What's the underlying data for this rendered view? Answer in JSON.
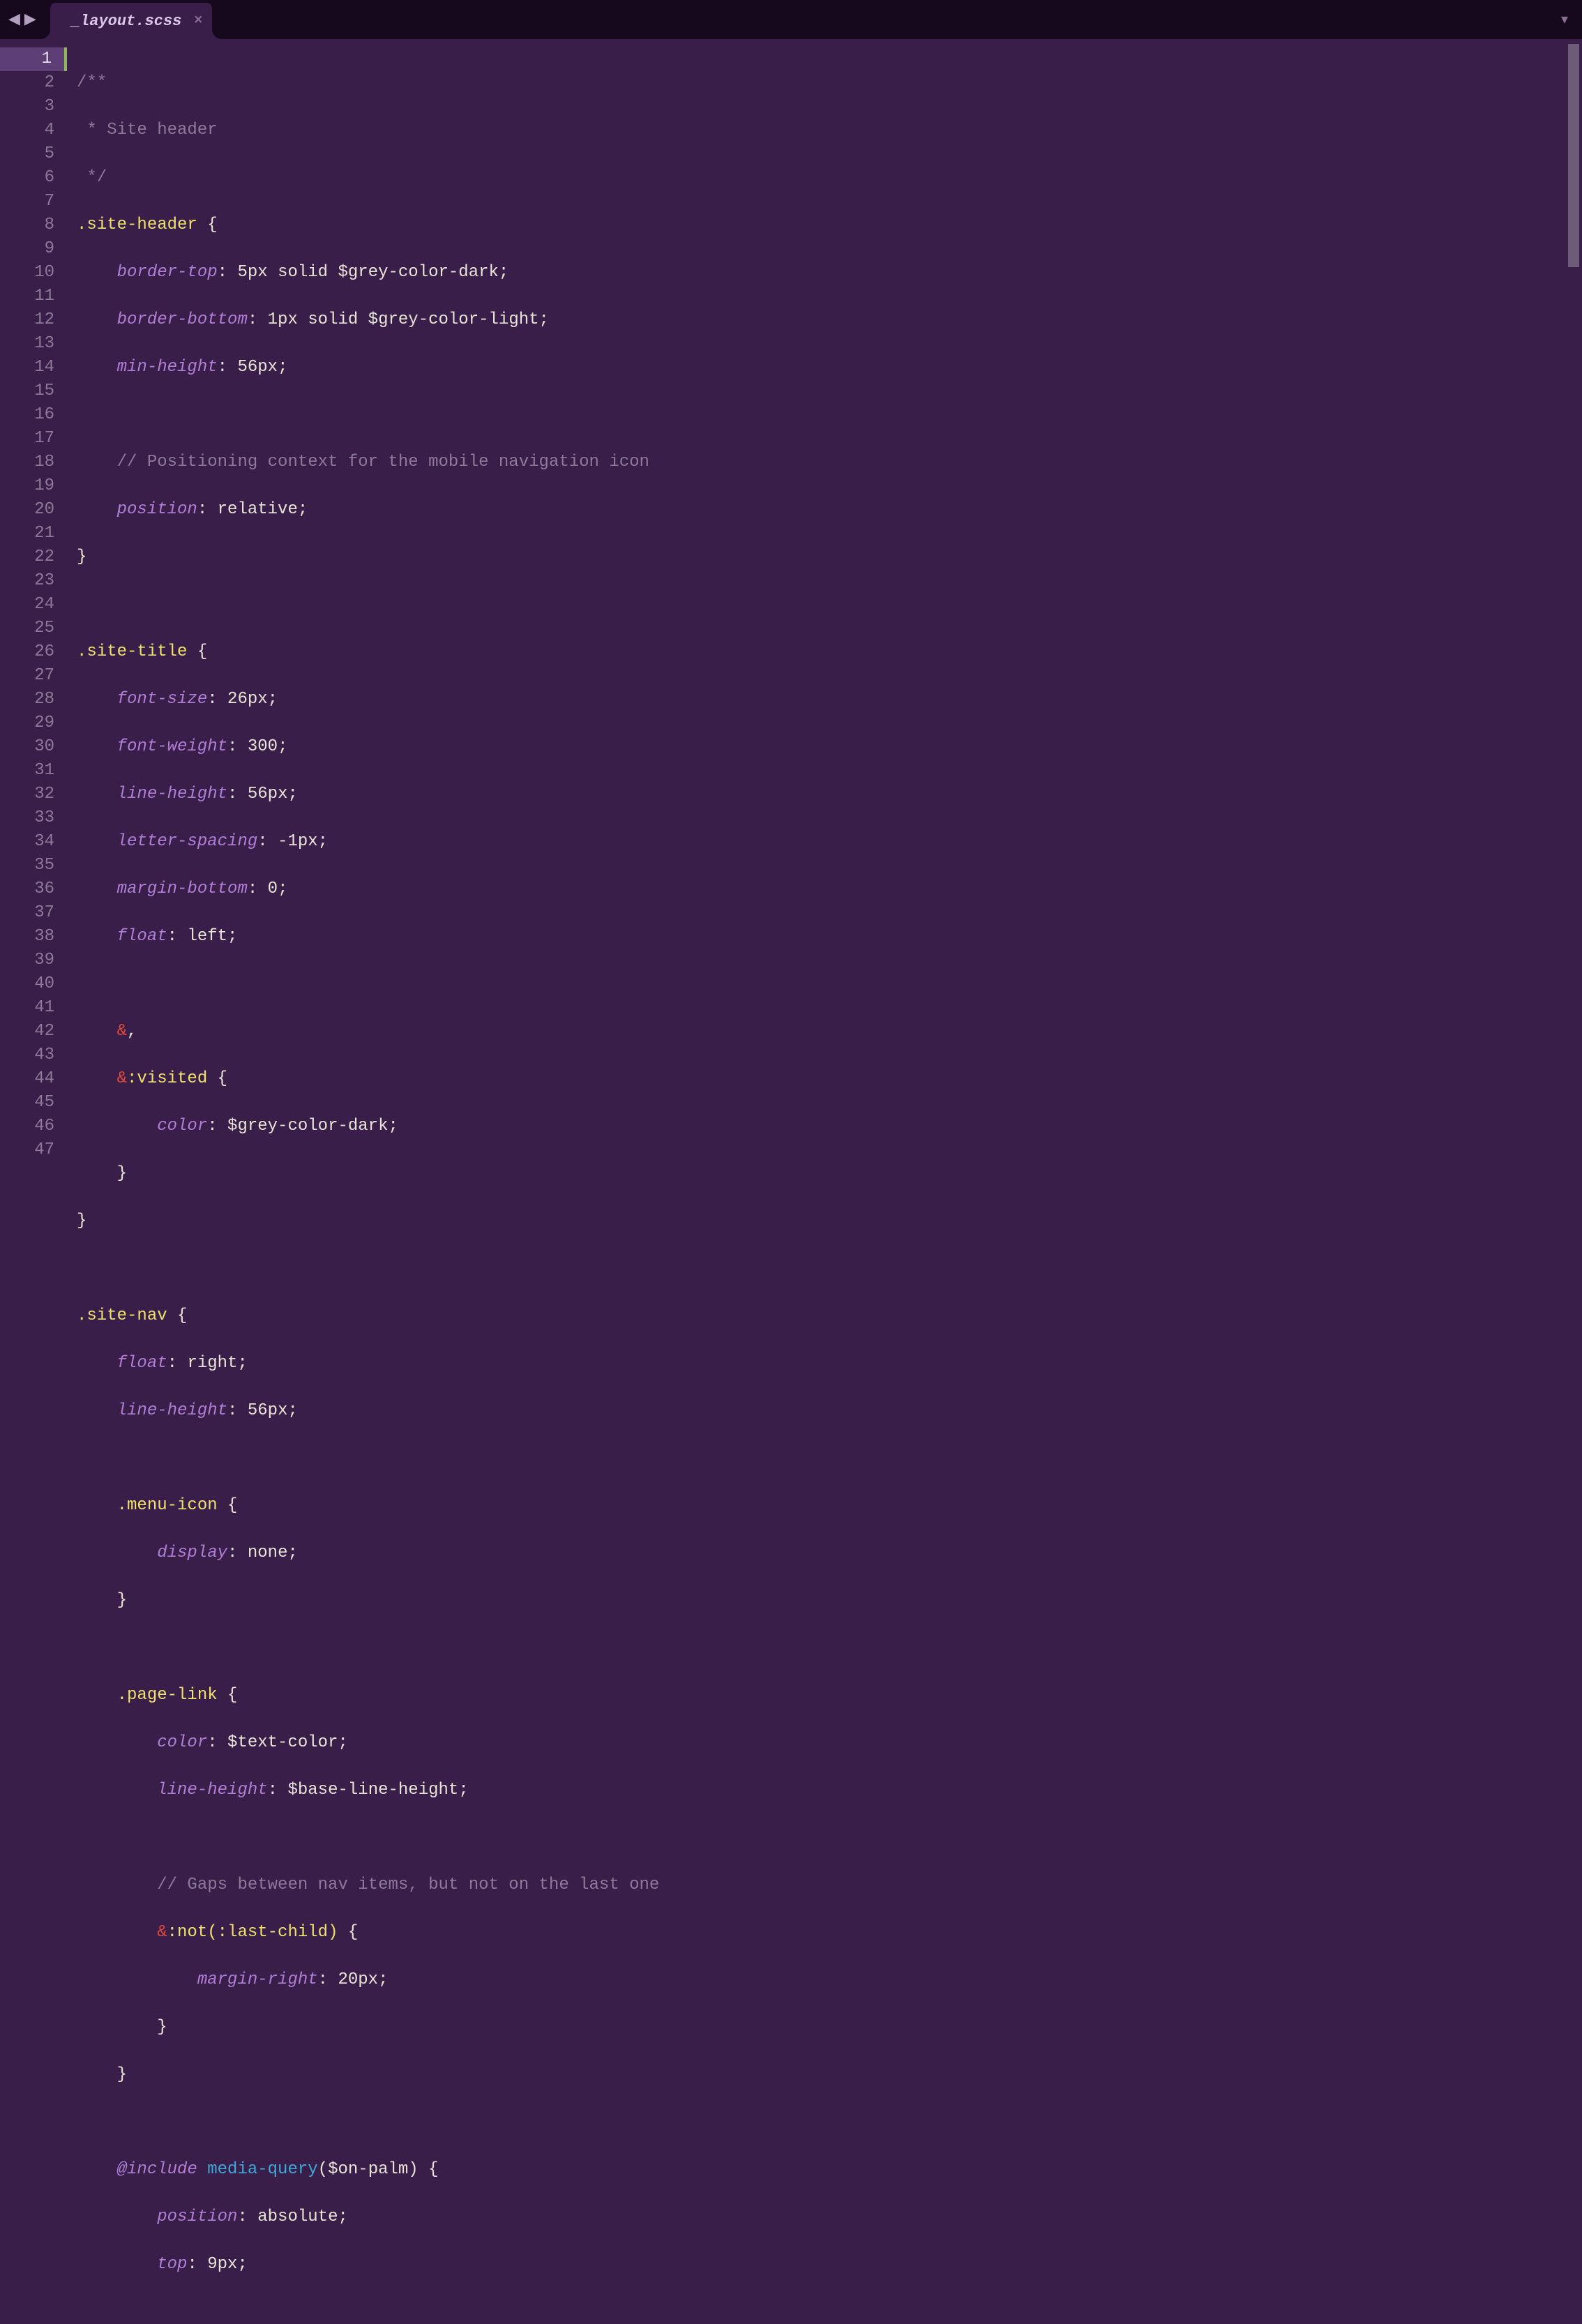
{
  "tab": {
    "title": "_layout.scss",
    "close": "×"
  },
  "overflow_glyph": "▾",
  "nav": {
    "back": "◀",
    "fwd": "▶"
  },
  "lines": {
    "numbers": [
      "1",
      "2",
      "3",
      "4",
      "5",
      "6",
      "7",
      "8",
      "9",
      "10",
      "11",
      "12",
      "13",
      "14",
      "15",
      "16",
      "17",
      "18",
      "19",
      "20",
      "21",
      "22",
      "23",
      "24",
      "25",
      "26",
      "27",
      "28",
      "29",
      "30",
      "31",
      "32",
      "33",
      "34",
      "35",
      "36",
      "37",
      "38",
      "39",
      "40",
      "41",
      "42",
      "43",
      "44",
      "45",
      "46",
      "47"
    ],
    "current": 1
  },
  "code": {
    "l1": "/**",
    "l2": " * Site header",
    "l3": " */",
    "l4_sel": ".site-header",
    "l5_p": "border-top",
    "l5_v": "5px solid $grey-color-dark",
    "l6_p": "border-bottom",
    "l6_v": "1px solid $grey-color-light",
    "l7_p": "min-height",
    "l7_v": "56px",
    "l9": "// Positioning context for the mobile navigation icon",
    "l10_p": "position",
    "l10_v": "relative",
    "l13_sel": ".site-title",
    "l14_p": "font-size",
    "l14_v": "26px",
    "l15_p": "font-weight",
    "l15_v": "300",
    "l16_p": "line-height",
    "l16_v": "56px",
    "l17_p": "letter-spacing",
    "l17_v": "-1px",
    "l18_p": "margin-bottom",
    "l18_v": "0",
    "l19_p": "float",
    "l19_v": "left",
    "l21": "&",
    "l22_a": "&",
    "l22_ps": ":visited",
    "l23_p": "color",
    "l23_v": "$grey-color-dark",
    "l27_sel": ".site-nav",
    "l28_p": "float",
    "l28_v": "right",
    "l29_p": "line-height",
    "l29_v": "56px",
    "l31_sel": ".menu-icon",
    "l32_p": "display",
    "l32_v": "none",
    "l35_sel": ".page-link",
    "l36_p": "color",
    "l36_v": "$text-color",
    "l37_p": "line-height",
    "l37_v": "$base-line-height",
    "l39": "// Gaps between nav items, but not on the last one",
    "l40_a": "&",
    "l40_ps": ":not(:last-child)",
    "l41_p": "margin-right",
    "l41_v": "20px",
    "l45_kw": "@include",
    "l45_fn": "media-query",
    "l45_arg": "$on-palm",
    "l46_p": "position",
    "l46_v": "absolute",
    "l47_p": "top",
    "l47_v": "9px"
  }
}
